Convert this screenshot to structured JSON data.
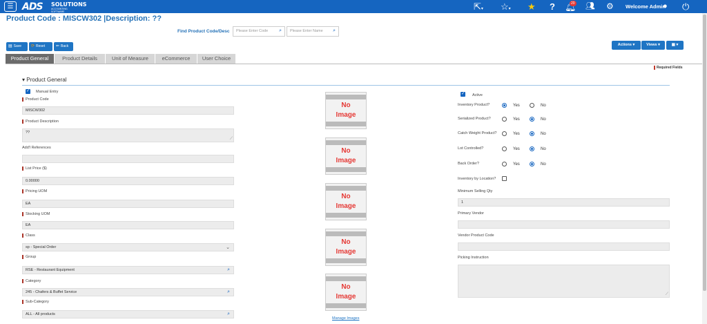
{
  "topbar": {
    "logo_main": "ADS",
    "logo_sub": "SOLUTIONS",
    "logo_tag": "ACCOUNTING SOFTWARE",
    "notification_count": "20",
    "welcome": "Welcome Admin",
    "icons": [
      "menu-icon",
      "share-icon",
      "star-outline-icon",
      "star-icon",
      "help-icon",
      "bell-icon",
      "users-icon",
      "gear-icon",
      "user-icon",
      "power-icon"
    ],
    "bar_color": "#1565c0"
  },
  "page": {
    "title": "Product Code  : MISCW302 |Description: ??"
  },
  "find": {
    "label": "Find Product Code/Desc",
    "code_placeholder": "Please Enter Code",
    "name_placeholder": "Please Enter Name"
  },
  "toolbar": {
    "save": "Save",
    "reset": "Reset",
    "back": "Back",
    "actions": "Actions ▾",
    "views": "Views ▾",
    "grid": "▦ ▾"
  },
  "tabs": [
    "Product General",
    "Product Details",
    "Unit of Measure",
    "eCommerce",
    "User Choice"
  ],
  "required_fields": "Required Fields",
  "section": {
    "title": "Product General",
    "manual_entry": "Manual Entry"
  },
  "left": {
    "product_code_label": "Product Code",
    "product_code": "MISCW302",
    "description_label": "Product Description",
    "description": "??",
    "addl_refs_label": "Add'l References",
    "addl_refs": "",
    "list_price_label": "List Price ($)",
    "list_price": "0.00000",
    "pricing_uom_label": "Pricing UOM",
    "pricing_uom": "EA",
    "stocking_uom_label": "Stocking UOM",
    "stocking_uom": "EA",
    "class_label": "Class",
    "class": "sp - Special Order",
    "group_label": "Group",
    "group": "RSE - Restaurant Equipment",
    "category_label": "Category",
    "category": "245 - Chafers & Buffet Service",
    "subcategory_label": "Sub-Category",
    "subcategory": "ALL - All products"
  },
  "images": {
    "line1": "No",
    "line2": "Image",
    "manage": "Manage Images"
  },
  "right": {
    "active": "Active",
    "yes": "Yes",
    "no": "No",
    "inventory_product": "Inventory Product?",
    "serialized_product": "Serialized Product?",
    "catch_weight": "Catch Weight Product?",
    "lot_controlled": "Lot Controlled?",
    "back_order": "Back Order?",
    "inventory_by_location": "Inventory by Location?",
    "min_selling_qty_label": "Minimum Selling Qty",
    "min_selling_qty": "1",
    "primary_vendor_label": "Primary Vendor",
    "primary_vendor": "",
    "vendor_code_label": "Vendor Product Code",
    "vendor_code": "",
    "picking_label": "Picking Instruction",
    "picking": ""
  }
}
